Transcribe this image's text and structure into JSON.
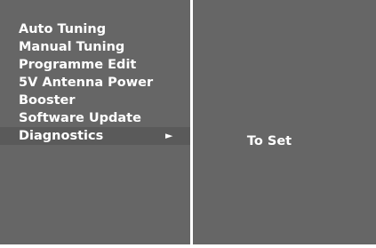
{
  "menu": {
    "items": [
      {
        "label": "Auto Tuning"
      },
      {
        "label": "Manual Tuning"
      },
      {
        "label": "Programme Edit"
      },
      {
        "label": "5V Antenna Power"
      },
      {
        "label": "Booster"
      },
      {
        "label": "Software Update"
      },
      {
        "label": "Diagnostics",
        "selected": true,
        "submenu_arrow": "►"
      }
    ]
  },
  "detail": {
    "label": "To Set"
  },
  "colors": {
    "panel_background": "#666666",
    "selected_row": "#5a5a5a",
    "divider": "#ffffff",
    "text": "#ffffff"
  },
  "icons": {
    "submenu": "play-arrow-icon"
  }
}
